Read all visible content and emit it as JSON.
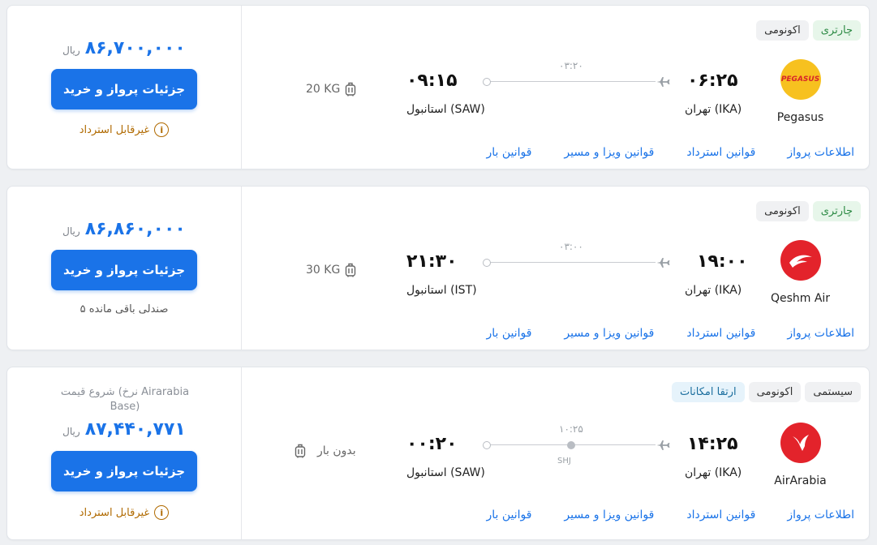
{
  "colors": {
    "accent": "#1a73e8",
    "warning": "#b06a00",
    "charter_green": "#2e8b46"
  },
  "links": {
    "flight_info": "اطلاعات پرواز",
    "refund_rules": "قوانین استرداد",
    "visa_rules": "قوانین ویزا و مسیر",
    "baggage_rules": "قوانین بار"
  },
  "buy_label": "جزئیات پرواز و خرید",
  "currency": "ریال",
  "flights": [
    {
      "tags": [
        "چارتری",
        "اکونومی"
      ],
      "airline": "Pegasus",
      "logo_icon": "pegasus-logo",
      "logo_text": "PEGASUS",
      "dep_time": "۰۶:۲۵",
      "dep_city": "تهران (IKA)",
      "arr_time": "۰۹:۱۵",
      "arr_city": "استانبول (SAW)",
      "duration": "۰۳:۲۰",
      "baggage": "20 KG",
      "price": "۸۶,۷۰۰,۰۰۰",
      "status": "غیرقابل استرداد"
    },
    {
      "tags": [
        "چارتری",
        "اکونومی"
      ],
      "airline": "Qeshm Air",
      "logo_icon": "qeshm-air-logo",
      "dep_time": "۱۹:۰۰",
      "dep_city": "تهران (IKA)",
      "arr_time": "۲۱:۳۰",
      "arr_city": "استانبول (IST)",
      "duration": "۰۳:۰۰",
      "baggage": "30 KG",
      "price": "۸۶,۸۶۰,۰۰۰",
      "status": "۵ صندلی باقی مانده"
    },
    {
      "tags": [
        "سیستمی",
        "اکونومی",
        "ارتقا امکانات"
      ],
      "airline": "AirArabia",
      "logo_icon": "airarabia-logo",
      "dep_time": "۱۴:۲۵",
      "dep_city": "تهران (IKA)",
      "arr_time": "۰۰:۲۰",
      "arr_city": "استانبول (SAW)",
      "duration": "۱۰:۲۵",
      "stop": "SHJ",
      "baggage": "بدون بار",
      "price_note": "شروع قیمت (نرخ Airarabia Base)",
      "price": "۸۷,۴۴۰,۷۷۱",
      "status": "غیرقابل استرداد"
    }
  ]
}
